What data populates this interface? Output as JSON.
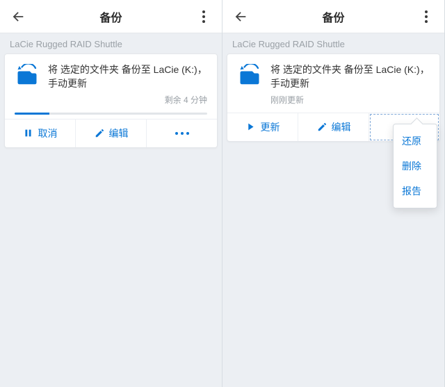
{
  "header": {
    "title": "备份"
  },
  "colors": {
    "accent": "#0a77d6"
  },
  "left": {
    "device": "LaCie Rugged RAID Shuttle",
    "plan_title": "将 选定的文件夹 备份至 LaCie (K:)，手动更新",
    "status": "剩余 4 分钟",
    "progress_pct": 18,
    "actions": {
      "cancel": "取消",
      "edit": "编辑"
    }
  },
  "right": {
    "device": "LaCie Rugged RAID Shuttle",
    "plan_title": "将 选定的文件夹 备份至 LaCie (K:)，手动更新",
    "status": "刚刚更新",
    "actions": {
      "update": "更新",
      "edit": "编辑"
    },
    "menu": {
      "restore": "还原",
      "delete": "删除",
      "report": "报告"
    }
  }
}
